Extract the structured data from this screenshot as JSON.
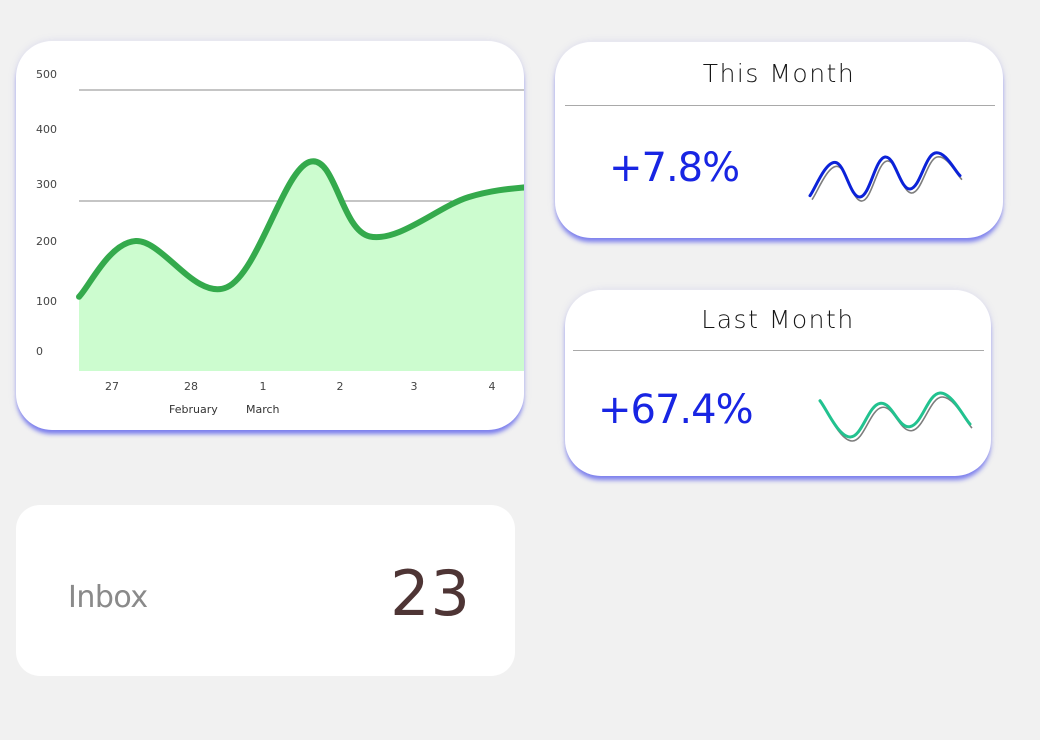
{
  "chart_data": {
    "type": "area",
    "y_ticks": [
      "500",
      "400",
      "300",
      "200",
      "100",
      "0"
    ],
    "x_ticks": [
      "27",
      "28",
      "1",
      "2",
      "3",
      "4"
    ],
    "x_month_labels": [
      "February",
      "March"
    ],
    "x": [
      26.45,
      27.3,
      28.5,
      1.6,
      2.4,
      3.7,
      4.4
    ],
    "y": [
      107,
      200,
      123,
      340,
      208,
      277,
      296
    ],
    "ylim": [
      0,
      500
    ],
    "grid": true,
    "line_color": "#34aa4c",
    "fill_color": "#ccfccf"
  },
  "this_month": {
    "title": "This Month",
    "value": "+7.8%",
    "spark_color": "#0b22d8",
    "spark_values": [
      3,
      28,
      2,
      32,
      8,
      35,
      18
    ]
  },
  "last_month": {
    "title": "Last Month",
    "value": "+67.4%",
    "spark_color": "#22c28f",
    "spark_values": [
      30,
      2,
      28,
      10,
      36,
      12
    ]
  },
  "inbox": {
    "label": "Inbox",
    "count": "23"
  }
}
